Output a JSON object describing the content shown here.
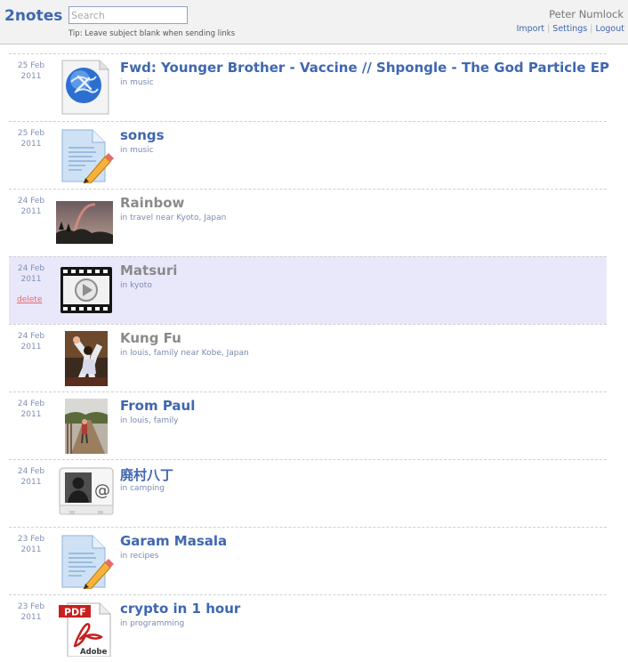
{
  "app": {
    "name": "2notes"
  },
  "search": {
    "placeholder": "Search",
    "value": ""
  },
  "tip": "Tip: Leave subject blank when sending links",
  "user": {
    "name": "Peter Numlock"
  },
  "nav": {
    "import": "Import",
    "settings": "Settings",
    "logout": "Logout",
    "sep": "|"
  },
  "notes": [
    {
      "day": "25 Feb",
      "year": "2011",
      "title": "Fwd: Younger Brother - Vaccine // Shpongle - The God Particle EP",
      "meta": "in music",
      "icon": "web-link-icon"
    },
    {
      "day": "25 Feb",
      "year": "2011",
      "title": "songs",
      "meta": "in music",
      "icon": "text-document-icon"
    },
    {
      "day": "24 Feb",
      "year": "2011",
      "title": "Rainbow",
      "meta": "in travel near Kyoto, Japan",
      "icon": "rainbow-photo-thumbnail"
    },
    {
      "day": "24 Feb",
      "year": "2011",
      "title": "Matsuri",
      "meta": "in kyoto",
      "icon": "video-file-icon",
      "action": "delete"
    },
    {
      "day": "24 Feb",
      "year": "2011",
      "title": "Kung Fu",
      "meta": "in louis, family near Kobe, Japan",
      "icon": "kung-fu-photo-thumbnail"
    },
    {
      "day": "24 Feb",
      "year": "2011",
      "title": "From Paul",
      "meta": "in louis, family",
      "icon": "walkway-photo-thumbnail"
    },
    {
      "day": "24 Feb",
      "year": "2011",
      "title": "廃村八丁",
      "meta": "in camping",
      "icon": "contact-card-icon"
    },
    {
      "day": "23 Feb",
      "year": "2011",
      "title": "Garam Masala",
      "meta": "in recipes",
      "icon": "text-document-icon"
    },
    {
      "day": "23 Feb",
      "year": "2011",
      "title": "crypto in 1 hour",
      "meta": "in programming",
      "icon": "pdf-file-icon",
      "pdf_label": "PDF",
      "adobe_label": "Adobe"
    }
  ],
  "colors": {
    "accent": "#3f67b0",
    "muted_title": "#8a8a8a",
    "highlight": "#e9e8fb",
    "delete": "#e06a6a"
  }
}
